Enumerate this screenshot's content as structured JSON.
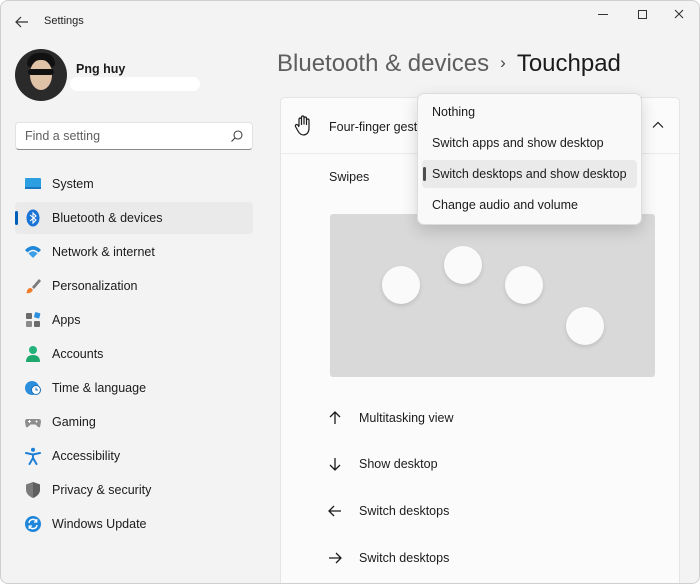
{
  "window": {
    "title": "Settings"
  },
  "profile": {
    "name": "Png huy"
  },
  "search": {
    "placeholder": "Find a setting"
  },
  "sidebar": {
    "items": [
      {
        "label": "System",
        "icon": "system-icon",
        "active": false
      },
      {
        "label": "Bluetooth & devices",
        "icon": "bluetooth-icon",
        "active": true
      },
      {
        "label": "Network & internet",
        "icon": "wifi-icon",
        "active": false
      },
      {
        "label": "Personalization",
        "icon": "paintbrush-icon",
        "active": false
      },
      {
        "label": "Apps",
        "icon": "apps-icon",
        "active": false
      },
      {
        "label": "Accounts",
        "icon": "person-icon",
        "active": false
      },
      {
        "label": "Time & language",
        "icon": "globe-clock-icon",
        "active": false
      },
      {
        "label": "Gaming",
        "icon": "gamepad-icon",
        "active": false
      },
      {
        "label": "Accessibility",
        "icon": "accessibility-icon",
        "active": false
      },
      {
        "label": "Privacy & security",
        "icon": "shield-icon",
        "active": false
      },
      {
        "label": "Windows Update",
        "icon": "update-icon",
        "active": false
      }
    ]
  },
  "breadcrumb": {
    "parent": "Bluetooth & devices",
    "separator": "›",
    "current": "Touchpad"
  },
  "gesture_card": {
    "title": "Four-finger gestu",
    "swipes_label": "Swipes",
    "directions": [
      {
        "arrow": "arrow-up-icon",
        "label": "Multitasking view"
      },
      {
        "arrow": "arrow-down-icon",
        "label": "Show desktop"
      },
      {
        "arrow": "arrow-left-icon",
        "label": "Switch desktops"
      },
      {
        "arrow": "arrow-right-icon",
        "label": "Switch desktops"
      }
    ]
  },
  "dropdown": {
    "options": [
      "Nothing",
      "Switch apps and show desktop",
      "Switch desktops and show desktop",
      "Change audio and volume"
    ],
    "selected_index": 2
  },
  "colors": {
    "accent": "#005fb8",
    "window_bg": "#f3f3f3",
    "card_bg": "#fbfbfb",
    "touchpad_bg": "#d9d9d9"
  }
}
